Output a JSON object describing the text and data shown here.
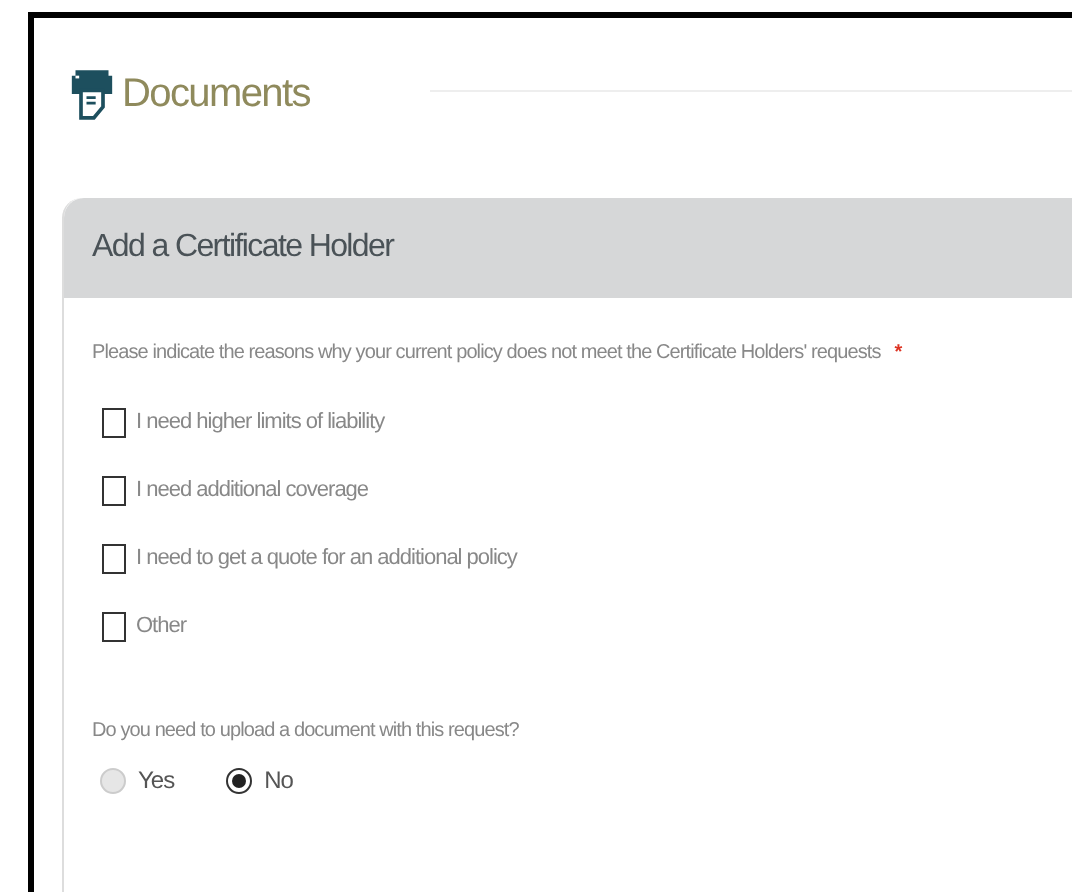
{
  "page": {
    "title": "Documents"
  },
  "panel": {
    "title": "Add a Certificate Holder",
    "reasons": {
      "question": "Please indicate the reasons why your current policy does not meet the Certificate Holders' requests",
      "required_mark": "*",
      "options": [
        {
          "label": "I need higher limits of liability",
          "checked": false
        },
        {
          "label": "I need additional coverage",
          "checked": false
        },
        {
          "label": "I need to get a quote for an additional policy",
          "checked": false
        },
        {
          "label": "Other",
          "checked": false
        }
      ]
    },
    "upload": {
      "question": "Do you need to upload a document with this request?",
      "options": [
        {
          "label": "Yes",
          "selected": false
        },
        {
          "label": "No",
          "selected": true
        }
      ]
    }
  }
}
